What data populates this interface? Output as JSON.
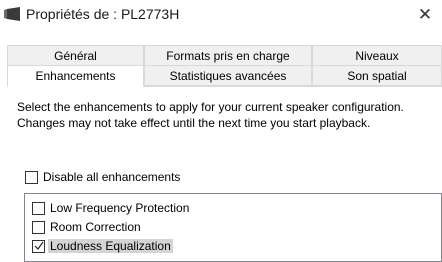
{
  "window": {
    "title": "Propriétés de : PL2773H",
    "close_glyph": "✕"
  },
  "tabs": {
    "row1": [
      {
        "label": "Général"
      },
      {
        "label": "Formats pris en charge"
      },
      {
        "label": "Niveaux"
      }
    ],
    "row2": [
      {
        "label": "Enhancements",
        "active": true
      },
      {
        "label": "Statistiques avancées"
      },
      {
        "label": "Son spatial"
      }
    ]
  },
  "enhancements": {
    "description": "Select the enhancements to apply for your current speaker configuration. Changes may not take effect until the next time you start playback.",
    "disable_all": {
      "label": "Disable all enhancements",
      "checked": false
    },
    "items": [
      {
        "label": "Low Frequency Protection",
        "checked": false
      },
      {
        "label": "Room Correction",
        "checked": false
      },
      {
        "label": "Loudness Equalization",
        "checked": true,
        "selected": true
      }
    ]
  },
  "icons": {
    "app": "speaker-icon",
    "close": "close-icon",
    "check": "checkmark-icon"
  },
  "colors": {
    "tab_bg": "#f0f0f0",
    "tab_border": "#d9d9d9",
    "selection": "#d4d4d4",
    "list_border": "#828790"
  }
}
